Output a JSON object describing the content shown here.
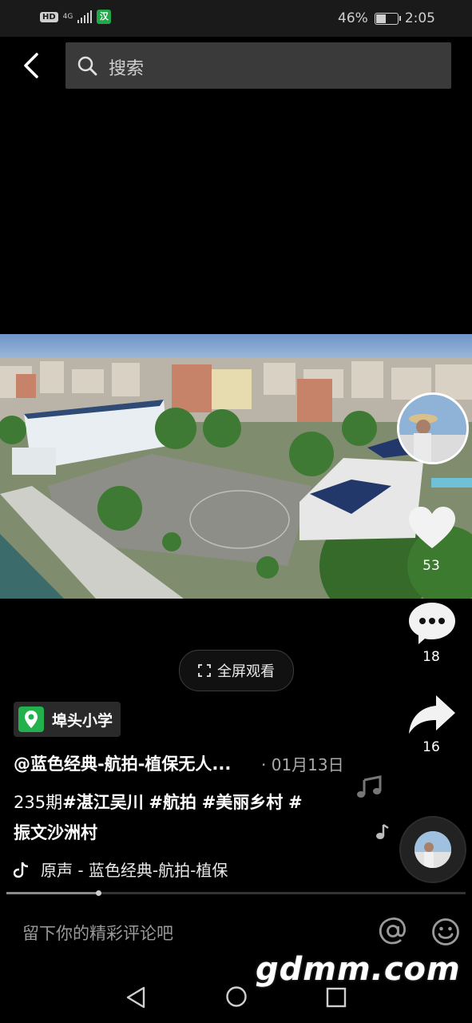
{
  "status": {
    "hd": "HD",
    "network": "4G",
    "app_badge": "汉",
    "battery": "46%",
    "time": "2:05"
  },
  "search": {
    "placeholder": "搜索"
  },
  "video": {
    "fullscreen_label": "全屏观看"
  },
  "side": {
    "likes": "53",
    "comments": "18",
    "shares": "16"
  },
  "post": {
    "location": "埠头小学",
    "author": "@蓝色经典-航拍-植保无人...",
    "date": "· 01月13日",
    "caption_prefix": "235期",
    "hashtags": [
      "#湛江吴川",
      "#航拍",
      "#美丽乡村",
      "#",
      "振文沙洲村"
    ],
    "music": "原声 - 蓝色经典-航拍-植保",
    "progress": 0.2
  },
  "comment": {
    "placeholder": "留下你的精彩评论吧"
  },
  "watermark": "gdmm.com",
  "icons": {
    "back": "chevron-left-icon",
    "search": "search-icon",
    "location": "location-pin-icon",
    "like": "heart-icon",
    "comment": "comment-bubble-icon",
    "share": "share-arrow-icon",
    "music": "music-note-icon",
    "at": "at-icon",
    "emoji": "emoji-icon"
  }
}
